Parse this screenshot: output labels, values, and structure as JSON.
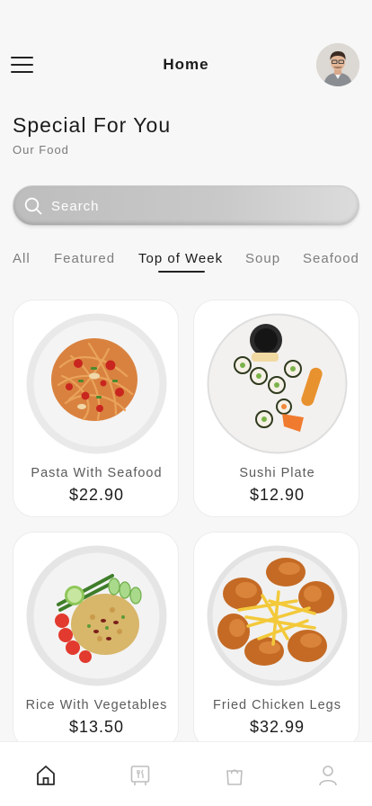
{
  "header": {
    "title": "Home",
    "menu_icon": "hamburger-menu-icon",
    "avatar_icon": "user-avatar"
  },
  "intro": {
    "heading": "Special For You",
    "subheading": "Our Food"
  },
  "search": {
    "placeholder": "Search",
    "icon": "search-icon"
  },
  "tabs": [
    {
      "label": "All",
      "active": false
    },
    {
      "label": "Featured",
      "active": false
    },
    {
      "label": "Top of Week",
      "active": true
    },
    {
      "label": "Soup",
      "active": false
    },
    {
      "label": "Seafood",
      "active": false
    }
  ],
  "foods": [
    {
      "name": "Pasta With Seafood",
      "price": "$22.90"
    },
    {
      "name": "Sushi Plate",
      "price": "$12.90"
    },
    {
      "name": "Rice With Vegetables",
      "price": "$13.50"
    },
    {
      "name": "Fried Chicken Legs",
      "price": "$32.99"
    }
  ],
  "bottom_nav": [
    {
      "icon": "home-icon",
      "active": true
    },
    {
      "icon": "menu-board-icon",
      "active": false
    },
    {
      "icon": "shopping-bag-icon",
      "active": false
    },
    {
      "icon": "profile-icon",
      "active": false
    }
  ],
  "colors": {
    "background": "#f7f7f7",
    "text_primary": "#1b1b1b",
    "text_muted": "#7d7d7d",
    "card": "#ffffff",
    "nav_inactive": "#bdbdbd"
  }
}
